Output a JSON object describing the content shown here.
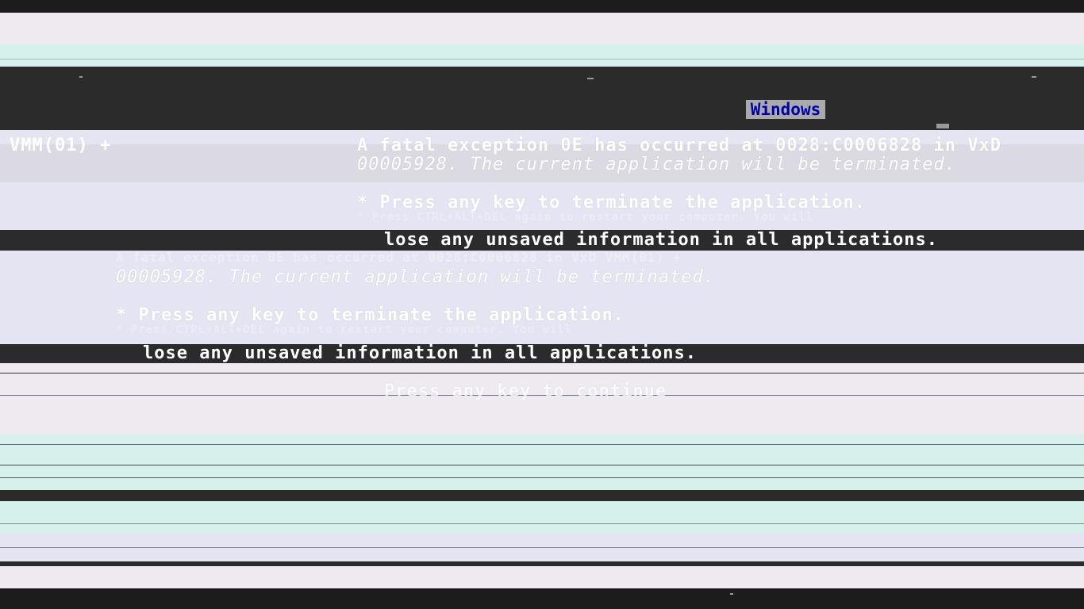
{
  "bsod": {
    "title": "Windows",
    "error_line_1_prefix": "VMM(01) +",
    "error_line_1": "A fatal exception 0E has occurred at 0028:C0006828 in VxD",
    "error_line_2": "00005928. The current application will be terminated.",
    "bullet_1": "* Press any key to terminate the application.",
    "bullet_2": "* Press CTRL+ALT+DEL again to restart your computer. You will",
    "bullet_2_cont": "lose any unsaved information in all applications.",
    "echo_line_1": "A fatal exception 0E has occurred at 0028:C0006828 in VxD VMM(01) +",
    "echo_line_2": "00005928. The current application will be terminated.",
    "echo_bullet_1": "* Press any key to terminate the application.",
    "echo_bullet_2": "* Press CTRL+ALT+DEL again to restart your computer. You will",
    "echo_bullet_2_cont": "lose any unsaved information in all applications.",
    "continue_prompt": "Press any key to continue"
  },
  "colors": {
    "badge_bg": "#aaaaaa",
    "badge_text": "#0000aa",
    "band_dark": "#2b2b2b",
    "band_pale": "#eeeaf0",
    "band_cyan": "#d6f0ec"
  }
}
